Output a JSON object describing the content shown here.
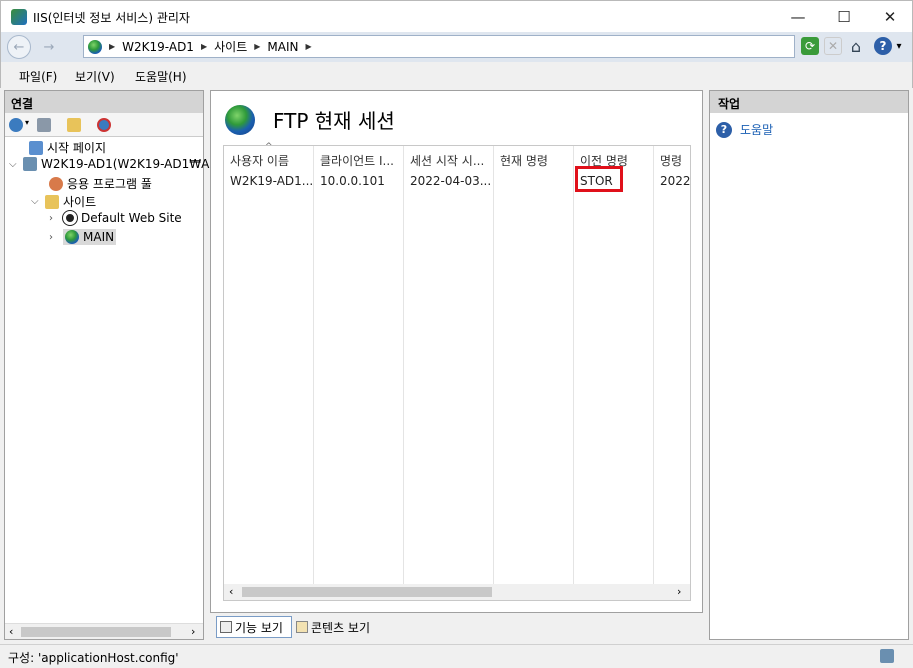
{
  "window": {
    "title": "IIS(인터넷 정보 서비스) 관리자",
    "minimize": "—",
    "maximize": "☐",
    "close": "✕"
  },
  "address": {
    "back": "←",
    "forward": "→",
    "path": [
      "W2K19-AD1",
      "사이트",
      "MAIN"
    ]
  },
  "toolbar": {
    "refresh": "⟳",
    "stop": "✕",
    "home": "⌂",
    "help": "?",
    "dropdown": "▾"
  },
  "menu": [
    "파일(F)",
    "보기(V)",
    "도움말(H)"
  ],
  "connections": {
    "title": "연결",
    "tree": [
      {
        "label": "시작 페이지",
        "icon": "start-page-icon"
      },
      {
        "label": "W2K19-AD1(W2K19-AD1₩A",
        "icon": "server-icon"
      },
      {
        "label": "응용 프로그램 풀",
        "icon": "app-pool-icon"
      },
      {
        "label": "사이트",
        "icon": "sites-folder-icon"
      },
      {
        "label": "Default Web Site",
        "icon": "website-stopped-icon"
      },
      {
        "label": "MAIN",
        "icon": "website-icon"
      }
    ]
  },
  "main": {
    "title": "FTP 현재 세션",
    "columns": [
      "사용자 이름",
      "클라이언트 I...",
      "세션 시작 시...",
      "현재 명령",
      "이전 명령",
      "명령"
    ],
    "rows": [
      [
        "W2K19-AD1...",
        "10.0.0.101",
        "2022-04-03...",
        "",
        "STOR",
        "2022"
      ]
    ],
    "highlight_color": "#e0101a"
  },
  "views": {
    "features": "기능 보기",
    "content": "콘텐츠 보기"
  },
  "actions": {
    "title": "작업",
    "items": [
      {
        "label": "도움말",
        "icon": "help-icon"
      }
    ]
  },
  "status": {
    "text": "구성: 'applicationHost.config'"
  }
}
